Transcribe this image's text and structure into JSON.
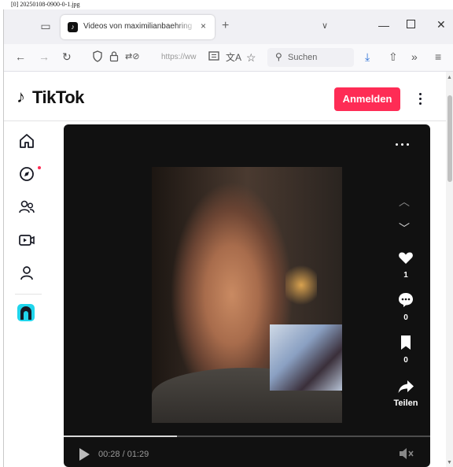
{
  "caption": "[0] 20250108-0900-0-1.jpg",
  "browser": {
    "tab": {
      "title": "Videos von maximilianbaehring",
      "close": "×"
    },
    "new_tab": "+",
    "overflow": "∨",
    "window_controls": {
      "minimize": "—",
      "maximize": "□",
      "close": "✕"
    },
    "url_text": "https://ww",
    "search_placeholder": "Suchen",
    "icons": [
      "back-arrow-icon",
      "forward-arrow-icon",
      "reload-icon",
      "shield-icon",
      "lock-icon",
      "permissions-icon",
      "reader-icon",
      "translate-icon",
      "bookmark-star-icon",
      "download-icon",
      "share-icon",
      "overflow-icon",
      "menu-icon"
    ]
  },
  "tiktok": {
    "logo_text": "TikTok",
    "login_label": "Anmelden",
    "accent": "#fe2c55",
    "sidebar": [
      "home-icon",
      "explore-icon",
      "following-icon",
      "live-icon",
      "profile-icon",
      "tiktok-app-icon"
    ],
    "video": {
      "likes": "1",
      "comments": "0",
      "saves": "0",
      "share_label": "Teilen",
      "time": "00:28 / 01:29",
      "progress": 0.31
    }
  }
}
